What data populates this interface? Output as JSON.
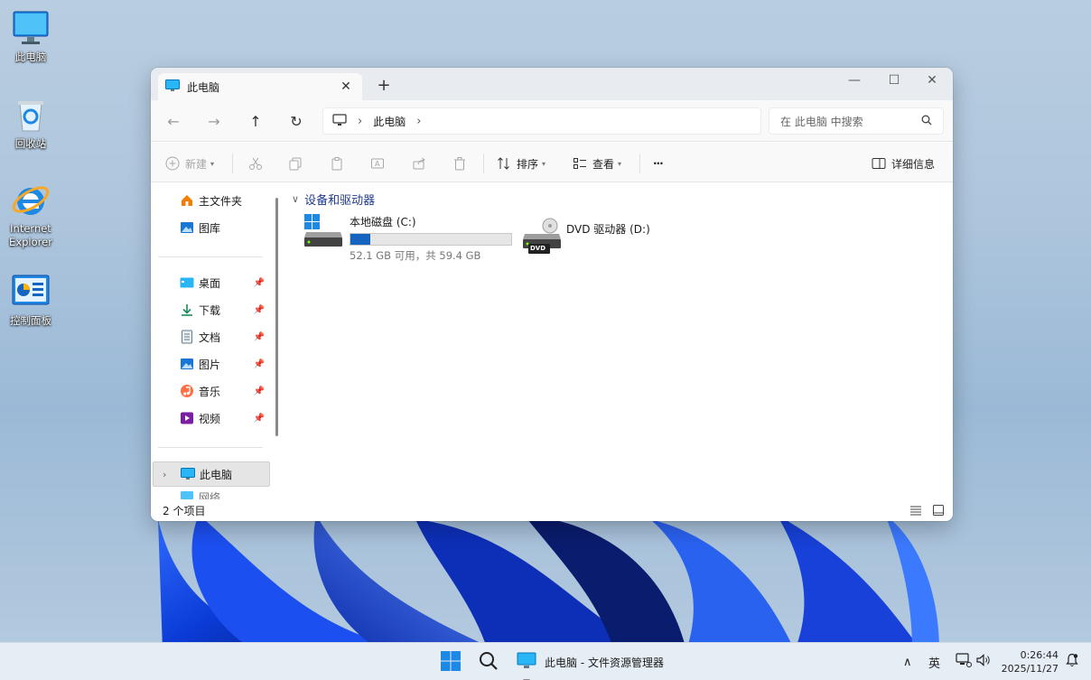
{
  "desktop": {
    "icons": [
      {
        "label": "此电脑",
        "icon": "computer-icon"
      },
      {
        "label": "回收站",
        "icon": "recycle-bin-icon"
      },
      {
        "label": "Internet Explorer",
        "icon": "ie-icon"
      },
      {
        "label": "控制面板",
        "icon": "control-panel-icon"
      }
    ]
  },
  "window": {
    "tab_title": "此电脑",
    "tab_close": "✕",
    "new_tab": "+",
    "controls": {
      "minimize": "—",
      "maximize": "☐",
      "close": "✕"
    },
    "nav": {
      "back": "←",
      "forward": "→",
      "up": "↑",
      "refresh": "↻"
    },
    "address": {
      "crumb": "此电脑",
      "chevron": "›"
    },
    "search": {
      "placeholder": "在 此电脑 中搜索"
    },
    "toolbar": {
      "new_label": "新建",
      "sort_label": "排序",
      "view_label": "查看",
      "more_label": "···",
      "details_label": "详细信息"
    },
    "sidebar": {
      "quick": [
        {
          "label": "主文件夹",
          "icon": "home-icon"
        },
        {
          "label": "图库",
          "icon": "gallery-icon"
        }
      ],
      "pinned": [
        {
          "label": "桌面",
          "icon": "desktop-icon"
        },
        {
          "label": "下载",
          "icon": "download-icon"
        },
        {
          "label": "文档",
          "icon": "document-icon"
        },
        {
          "label": "图片",
          "icon": "pictures-icon"
        },
        {
          "label": "音乐",
          "icon": "music-icon"
        },
        {
          "label": "视频",
          "icon": "video-icon"
        }
      ],
      "this_pc": "此电脑",
      "network_partial": "网络"
    },
    "content": {
      "group_title": "设备和驱动器",
      "drives": [
        {
          "name": "本地磁盘 (C:)",
          "free": "52.1 GB 可用，共 59.4 GB",
          "used_fraction": 0.123
        },
        {
          "name": "DVD 驱动器 (D:)",
          "badge": "DVD"
        }
      ]
    },
    "status": {
      "count": "2 个项目"
    }
  },
  "taskbar": {
    "app_label": "此电脑 - 文件资源管理器",
    "ime": "英",
    "time": "0:26:44",
    "date": "2025/11/27",
    "chevron": "∧"
  },
  "colors": {
    "accent": "#1565c0",
    "group_title": "#1f3a8a"
  }
}
